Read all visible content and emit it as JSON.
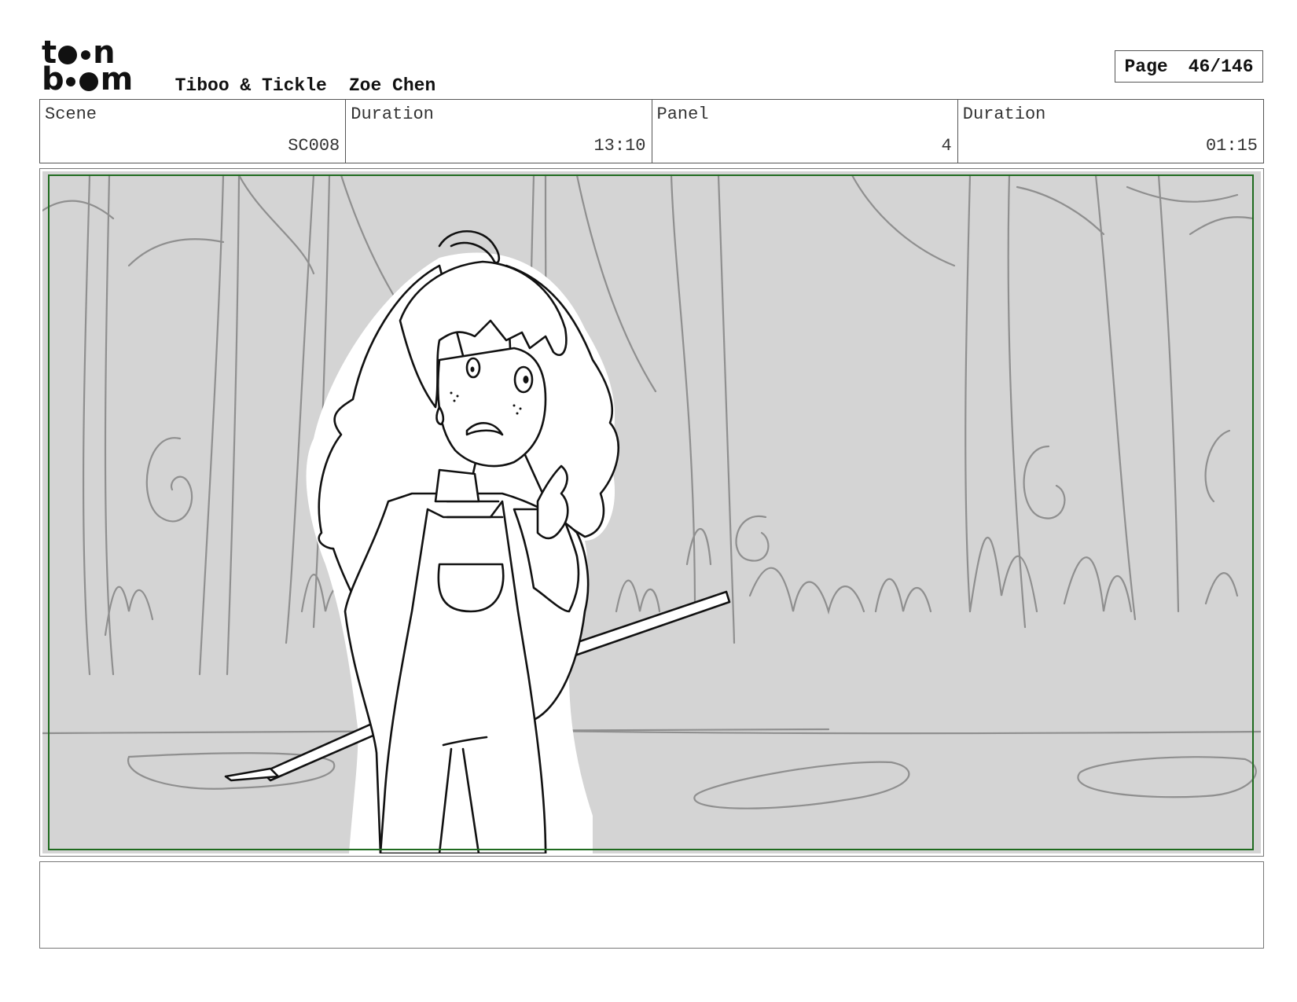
{
  "logo": {
    "line1": "t",
    "line1b": "n",
    "line2": "b",
    "line2b": "m",
    "brand": "toon boom"
  },
  "header": {
    "title": "Tiboo & Tickle",
    "author": "Zoe Chen",
    "page_label": "Page",
    "page_value": "46/146"
  },
  "info": {
    "scene_label": "Scene",
    "scene_value": "SC008",
    "scene_duration_label": "Duration",
    "scene_duration_value": "13:10",
    "panel_label": "Panel",
    "panel_value": "4",
    "panel_duration_label": "Duration",
    "panel_duration_value": "01:15"
  },
  "panel": {
    "background_color": "#d4d4d4",
    "safe_frame_color": "#1f6b1f",
    "sketch_color": "#8f8f8f",
    "ink_color": "#111111"
  },
  "notes": {
    "text": ""
  }
}
